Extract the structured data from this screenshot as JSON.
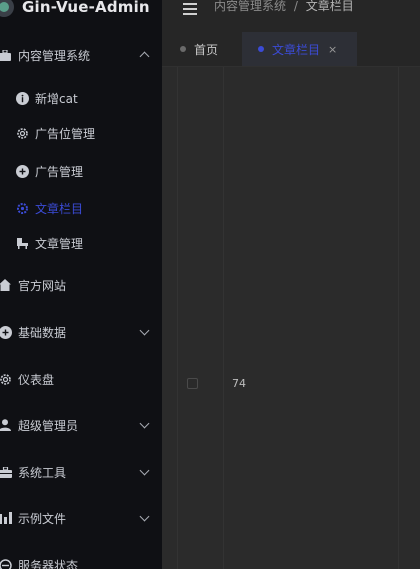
{
  "app": {
    "title": "Gin-Vue-Admin"
  },
  "header": {
    "breadcrumb": [
      "内容管理系统",
      "/",
      "文章栏目"
    ]
  },
  "tabs": [
    {
      "label": "首页"
    },
    {
      "label": "文章栏目",
      "close": "×"
    }
  ],
  "sidebar": {
    "groups": [
      {
        "label": "内容管理系统",
        "icon": "briefcase-icon"
      },
      {
        "label": "新增cat",
        "icon": "info-icon"
      },
      {
        "label": "广告位管理",
        "icon": "gear-icon"
      },
      {
        "label": "广告管理",
        "icon": "plus-circle-icon"
      },
      {
        "label": "文章栏目",
        "icon": "gear-icon",
        "active": true
      },
      {
        "label": "文章管理",
        "icon": "chair-icon"
      },
      {
        "label": "官方网站",
        "icon": "home-icon"
      },
      {
        "label": "基础数据",
        "icon": "plus-circle-icon"
      },
      {
        "label": "仪表盘",
        "icon": "gear-icon"
      },
      {
        "label": "超级管理员",
        "icon": "user-icon"
      },
      {
        "label": "系统工具",
        "icon": "toolbox-icon"
      },
      {
        "label": "示例文件",
        "icon": "bar-chart-icon"
      },
      {
        "label": "服务器状态",
        "icon": "server-icon"
      }
    ]
  },
  "table": {
    "rows": [
      {
        "value": "74"
      }
    ]
  },
  "colors": {
    "active": "#3b4bd6",
    "sidebar_bg": "#0f1014"
  }
}
